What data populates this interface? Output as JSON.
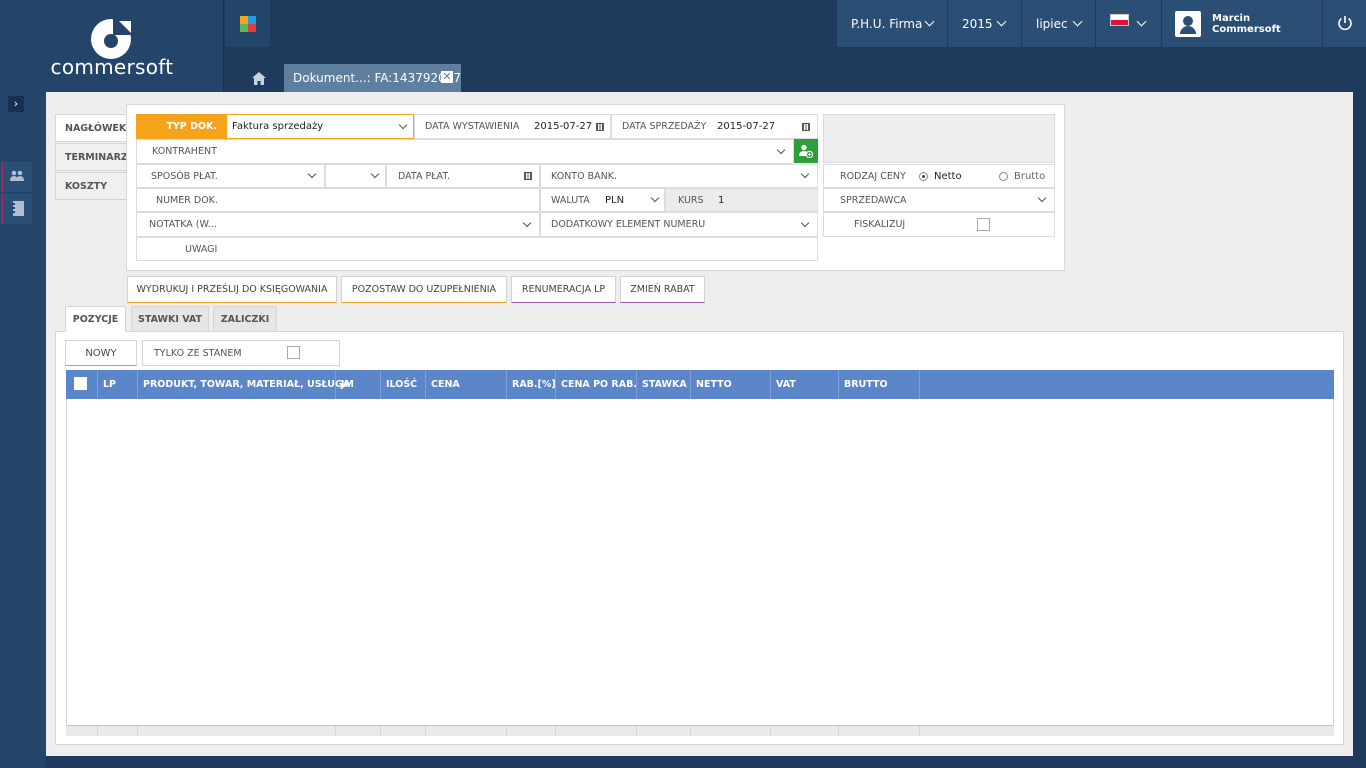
{
  "app": {
    "logo_text": "commersoft"
  },
  "topbar": {
    "company": "P.H.U. Firma",
    "year": "2015",
    "month": "lipiec",
    "user": "Marcin Commersoft"
  },
  "tabs": {
    "doc_tab_label": "Dokument...: FA:143792047"
  },
  "side_tabs": [
    "NAGŁÓWEK",
    "TERMINARZ",
    "KOSZTY"
  ],
  "form": {
    "typ_dok_label": "TYP DOK.",
    "typ_dok_value": "Faktura sprzedaży",
    "data_wystawienia_label": "DATA WYSTAWIENIA",
    "data_wystawienia_value": "2015-07-27",
    "data_sprzedazy_label": "DATA SPRZEDAŻY",
    "data_sprzedazy_value": "2015-07-27",
    "kontrahent_label": "KONTRAHENT",
    "sposob_plat_label": "SPOSÓB PŁAT.",
    "data_plat_label": "DATA PŁAT.",
    "konto_bank_label": "KONTO BANK.",
    "numer_dok_label": "NUMER DOK.",
    "waluta_label": "WALUTA",
    "waluta_value": "PLN",
    "kurs_label": "KURS",
    "kurs_value": "1",
    "notatka_label": "NOTATKA (W...",
    "dodatkowy_label": "DODATKOWY ELEMENT NUMERU",
    "uwagi_label": "UWAGI",
    "rodzaj_ceny_label": "RODZAJ CENY",
    "netto_label": "Netto",
    "brutto_label": "Brutto",
    "sprzedawca_label": "SPRZEDAWCA",
    "fiskalizuj_label": "FISKALIZUJ"
  },
  "actions": {
    "wydrukuj": "WYDRUKUJ I PRZEŚLIJ DO KSIĘGOWANIA",
    "pozostaw": "POZOSTAW DO UZUPEŁNIENIA",
    "renumeracja": "RENUMERACJA LP",
    "zmien_rabat": "ZMIEŃ RABAT"
  },
  "bottom_tabs": [
    "POZYCJE",
    "STAWKI VAT",
    "ZALICZKI"
  ],
  "grid_toolbar": {
    "nowy": "NOWY",
    "tylko_ze_stanem": "TYLKO ZE STANEM"
  },
  "grid_columns": [
    "LP",
    "PRODUKT, TOWAR, MATERIAŁ, USŁUGA",
    "JM",
    "ILOŚĆ",
    "CENA",
    "RAB.[%]",
    "CENA PO RAB.",
    "STAWKA",
    "NETTO",
    "VAT",
    "BRUTTO"
  ],
  "colors": {
    "accent_orange": "#f5a31a",
    "grid_header": "#5b86c9",
    "nav_dark": "#1f3a5c",
    "add_green": "#2e9d3a"
  }
}
